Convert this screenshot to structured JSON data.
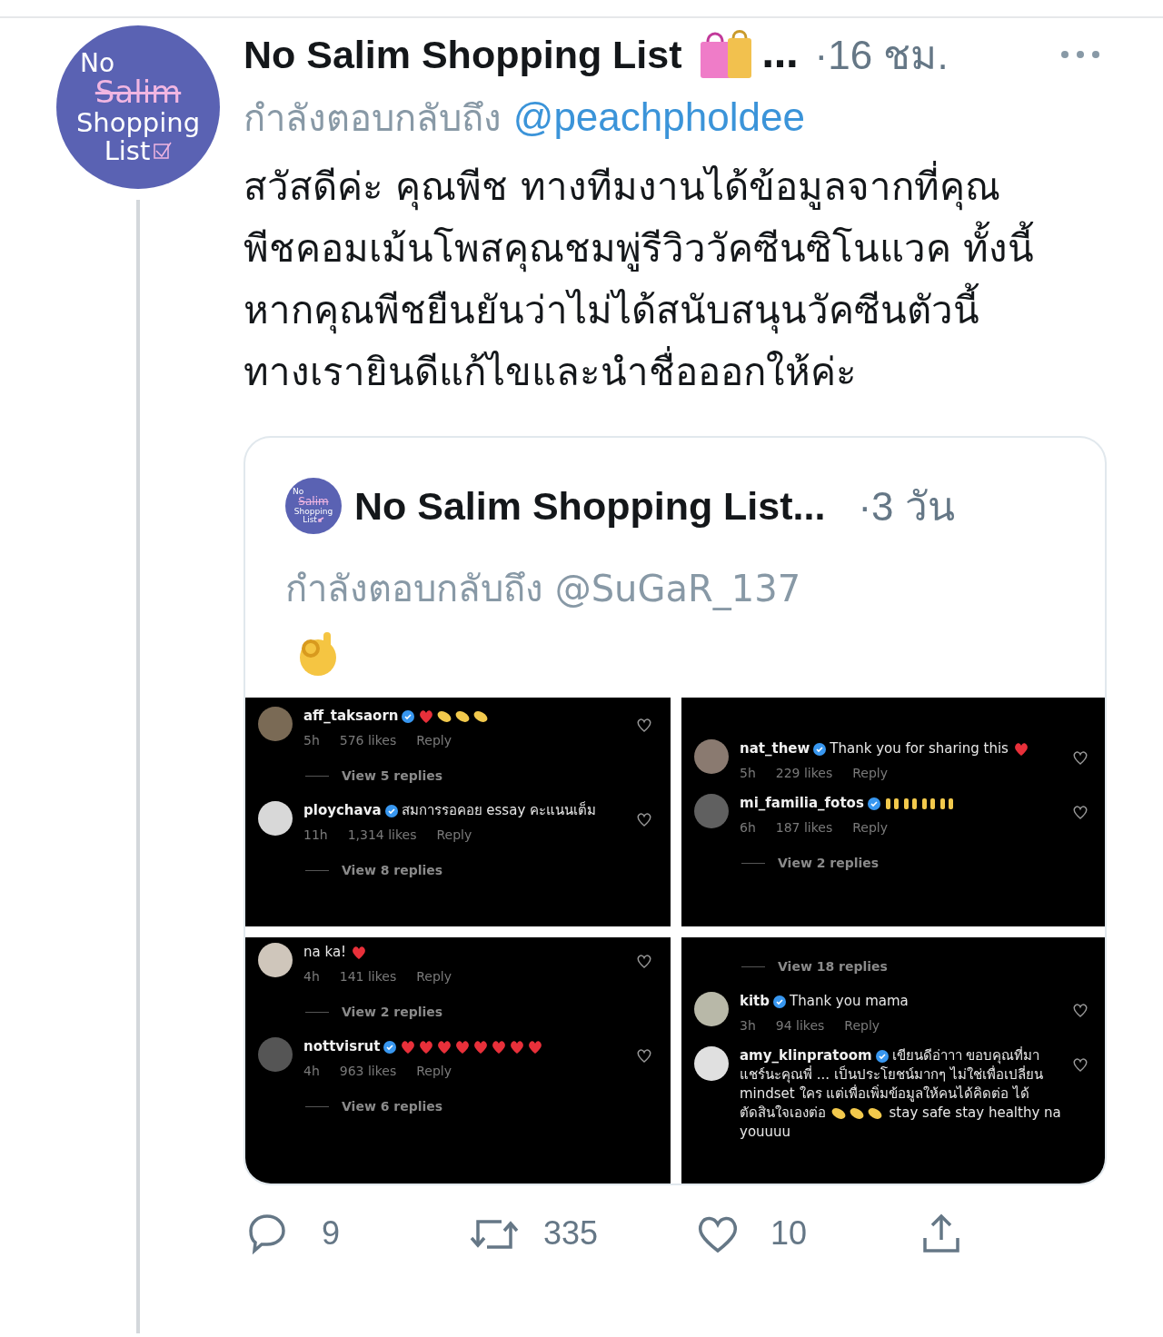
{
  "tweet": {
    "avatar": {
      "lines": [
        "No",
        "Salim",
        "Shopping",
        "List"
      ]
    },
    "name": "No Salim Shopping List",
    "name_suffix": "…",
    "time": "·16 ชม.",
    "reply_label": "กำลังตอบกลับถึง",
    "reply_handle": "@peachpholdee",
    "text": "สวัสดีค่ะ คุณพีช ทางทีมงานได้ข้อมูลจากที่คุณพีชคอมเม้นโพสคุณชมพู่รีวิววัคซีนซิโนแวค ทั้งนี้หากคุณพีชยืนยันว่าไม่ได้สนับสนุนวัคซีนตัวนี้ ทางเรายินดีแก้ไขและนำชื่อออกให้ค่ะ",
    "quote": {
      "avatar": {
        "lines": [
          "No",
          "Salim",
          "Shopping",
          "List"
        ]
      },
      "name": "No Salim Shopping List...",
      "time": "·3 วัน",
      "reply_label": "กำลังตอบกลับถึง",
      "reply_handle": "@SuGaR_137",
      "panels": [
        {
          "items": [
            {
              "kind": "comment",
              "user": "aff_taksaorn",
              "emojis": [
                {
                  "kind": "heart"
                },
                {
                  "kind": "clap"
                },
                {
                  "kind": "clap"
                },
                {
                  "kind": "clap"
                }
              ],
              "time": "5h",
              "likes": "576 likes",
              "reply": "Reply"
            },
            {
              "kind": "view_replies",
              "text": "View 5 replies"
            },
            {
              "kind": "comment",
              "user": "ploychava",
              "text": "สมการรอคอย essay คะแนนเต็ม",
              "time": "11h",
              "likes": "1,314 likes",
              "reply": "Reply"
            },
            {
              "kind": "view_replies",
              "text": "View 8 replies"
            }
          ]
        },
        {
          "items": [
            {
              "kind": "comment",
              "user": "nat_thew",
              "text": "Thank you for sharing this",
              "emojis": [
                {
                  "kind": "heart"
                }
              ],
              "time": "5h",
              "likes": "229 likes",
              "reply": "Reply"
            },
            {
              "kind": "comment",
              "user": "mi_familia_fotos",
              "emojis": [
                {
                  "kind": "hands"
                },
                {
                  "kind": "hands"
                },
                {
                  "kind": "hands"
                },
                {
                  "kind": "hands"
                }
              ],
              "time": "6h",
              "likes": "187 likes",
              "reply": "Reply"
            },
            {
              "kind": "view_replies",
              "text": "View 2 replies"
            }
          ]
        },
        {
          "items": [
            {
              "kind": "comment",
              "text": "na ka!",
              "emojis": [
                {
                  "kind": "heart"
                }
              ],
              "time": "4h",
              "likes": "141 likes",
              "reply": "Reply"
            },
            {
              "kind": "view_replies",
              "text": "View 2 replies"
            },
            {
              "kind": "comment",
              "user": "nottvisrut",
              "emojis": [
                {
                  "kind": "heart"
                },
                {
                  "kind": "heart"
                },
                {
                  "kind": "heart"
                },
                {
                  "kind": "heart"
                },
                {
                  "kind": "heart"
                },
                {
                  "kind": "heart"
                },
                {
                  "kind": "heart"
                },
                {
                  "kind": "heart"
                }
              ],
              "time": "4h",
              "likes": "963 likes",
              "reply": "Reply"
            },
            {
              "kind": "view_replies",
              "text": "View 6 replies"
            }
          ]
        },
        {
          "items": [
            {
              "kind": "view_replies",
              "text": "View 18 replies"
            },
            {
              "kind": "comment",
              "user": "kitb",
              "text": "Thank you mama",
              "time": "3h",
              "likes": "94 likes",
              "reply": "Reply"
            },
            {
              "kind": "comment",
              "user": "amy_klinpratoom",
              "text": "เขียนดีอ่าาา ขอบคุณที่มาแชร์นะคุณพี่ ... เป็นประโยชน์มากๆ ไม่ใช่เพื่อเปลี่ยน mindset ใคร แต่เพื่อเพิ่มข้อมูลให้คนได้คิดต่อ ได้ตัดสินใจเองต่อ",
              "emojis": [
                {
                  "kind": "clap"
                },
                {
                  "kind": "clap"
                },
                {
                  "kind": "clap"
                }
              ],
              "after": "stay safe stay healthy na youuuu"
            }
          ]
        }
      ]
    },
    "actions": [
      {
        "kind": "reply",
        "count": "9"
      },
      {
        "kind": "retweet",
        "count": "335"
      },
      {
        "kind": "like",
        "count": "10"
      },
      {
        "kind": "share"
      }
    ]
  }
}
